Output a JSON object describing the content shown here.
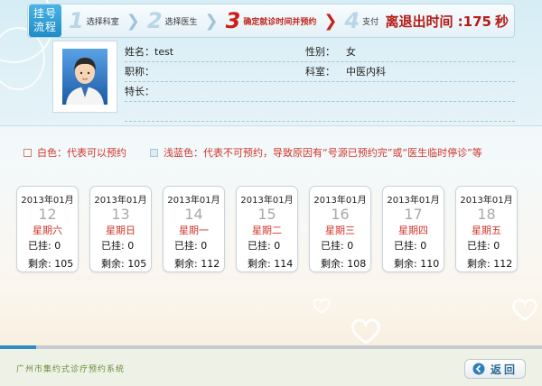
{
  "steps_title": "挂号\n流程",
  "steps": [
    {
      "num": "1",
      "label": "选择科室",
      "active": false
    },
    {
      "num": "2",
      "label": "选择医生",
      "active": false
    },
    {
      "num": "3",
      "label": "确定就诊时间并预约",
      "active": true
    },
    {
      "num": "4",
      "label": "支付",
      "active": false
    }
  ],
  "timer": {
    "label": "离退出时间 :",
    "value": "175",
    "unit": "秒"
  },
  "doctor": {
    "name_label": "姓名：test",
    "gender_label": "性别：",
    "gender": "女",
    "title_label": "职称：",
    "dept_label": "科室：",
    "dept": "中医内科",
    "specialty_label": "特长："
  },
  "legend": {
    "white": "白色：代表可以预约",
    "blue": "浅蓝色：代表不可预约，导致原因有“号源已预约完”或“医生临时停诊”等"
  },
  "days": [
    {
      "ym": "2013年01月",
      "day": "12",
      "week": "星期六",
      "booked": "已挂: 0",
      "remain": "剩余: 105"
    },
    {
      "ym": "2013年01月",
      "day": "13",
      "week": "星期日",
      "booked": "已挂: 0",
      "remain": "剩余: 105"
    },
    {
      "ym": "2013年01月",
      "day": "14",
      "week": "星期一",
      "booked": "已挂: 0",
      "remain": "剩余: 112"
    },
    {
      "ym": "2013年01月",
      "day": "15",
      "week": "星期二",
      "booked": "已挂: 0",
      "remain": "剩余: 114"
    },
    {
      "ym": "2013年01月",
      "day": "16",
      "week": "星期三",
      "booked": "已挂: 0",
      "remain": "剩余: 108"
    },
    {
      "ym": "2013年01月",
      "day": "17",
      "week": "星期四",
      "booked": "已挂: 0",
      "remain": "剩余: 110"
    },
    {
      "ym": "2013年01月",
      "day": "18",
      "week": "星期五",
      "booked": "已挂: 0",
      "remain": "剩余: 112"
    }
  ],
  "footer": {
    "system_name": "广州市集约式诊疗预约系统",
    "back_label": "返回"
  },
  "icons": {
    "avatar": "doctor-avatar-icon",
    "back": "back-arrow-icon"
  }
}
